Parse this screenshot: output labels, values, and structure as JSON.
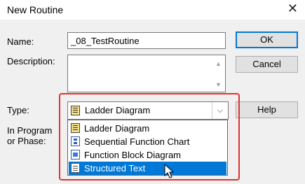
{
  "window": {
    "title": "New Routine",
    "close_glyph": "✕"
  },
  "form": {
    "name_label": "Name:",
    "name_value": "_08_TestRoutine",
    "description_label": "Description:",
    "description_value": "",
    "type_label": "Type:",
    "type_value": "Ladder Diagram",
    "program_label_line1": "In Program",
    "program_label_line2": "or Phase:"
  },
  "buttons": {
    "ok": "OK",
    "cancel": "Cancel",
    "help": "Help"
  },
  "dropdown": {
    "options": [
      {
        "label": "Ladder Diagram",
        "icon": "ladder-diagram-icon"
      },
      {
        "label": "Sequential Function Chart",
        "icon": "sfc-icon"
      },
      {
        "label": "Function Block Diagram",
        "icon": "fbd-icon"
      },
      {
        "label": "Structured Text",
        "icon": "structured-text-icon"
      }
    ],
    "highlighted": "Structured Text"
  },
  "colors": {
    "highlight": "#0078d7",
    "annotation": "#e53030"
  }
}
